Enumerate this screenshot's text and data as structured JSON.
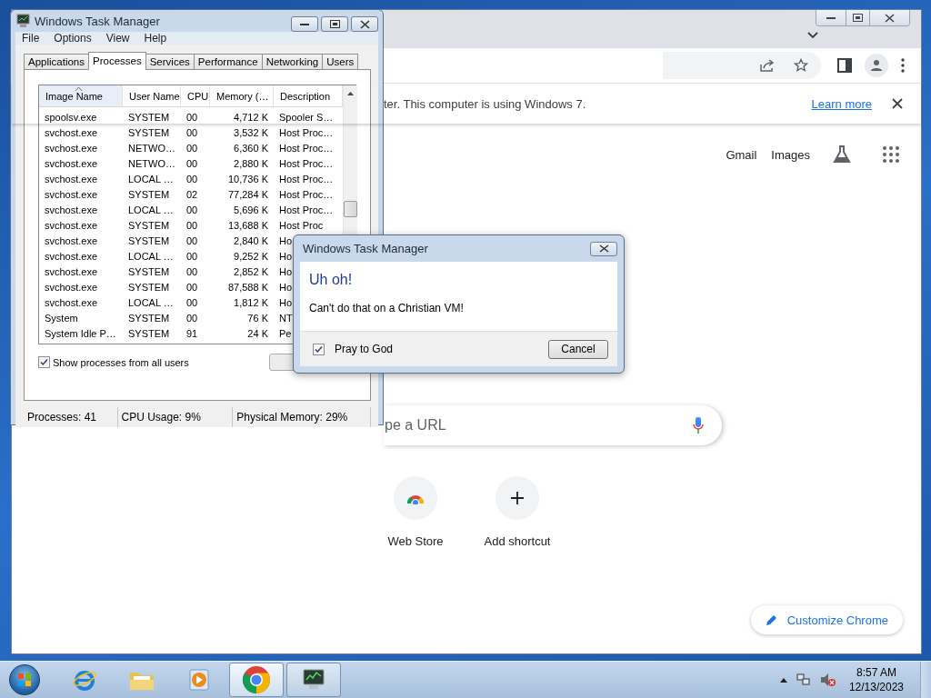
{
  "chrome": {
    "infobar": {
      "text": "ter. This computer is using Windows 7.",
      "link": "Learn more"
    },
    "header_links": [
      "Gmail",
      "Images"
    ],
    "search": {
      "placeholder": "pe a URL"
    },
    "shortcuts": [
      {
        "label": "Web Store",
        "kind": "store"
      },
      {
        "label": "Add shortcut",
        "kind": "add"
      }
    ],
    "customize_button": "Customize Chrome"
  },
  "task_manager": {
    "title": "Windows Task Manager",
    "menu": [
      "File",
      "Options",
      "View",
      "Help"
    ],
    "tabs": [
      {
        "label": "Applications",
        "selected": false
      },
      {
        "label": "Processes",
        "selected": true
      },
      {
        "label": "Services",
        "selected": false
      },
      {
        "label": "Performance",
        "selected": false
      },
      {
        "label": "Networking",
        "selected": false
      },
      {
        "label": "Users",
        "selected": false
      }
    ],
    "table": {
      "columns": [
        "Image Name",
        "User Name",
        "CPU",
        "Memory (…",
        "Description"
      ],
      "rows": [
        [
          "spoolsv.exe",
          "SYSTEM",
          "00",
          "4,712 K",
          "Spooler S…"
        ],
        [
          "svchost.exe",
          "SYSTEM",
          "00",
          "3,532 K",
          "Host Proc…"
        ],
        [
          "svchost.exe",
          "NETWO…",
          "00",
          "6,360 K",
          "Host Proc…"
        ],
        [
          "svchost.exe",
          "NETWO…",
          "00",
          "2,880 K",
          "Host Proc…"
        ],
        [
          "svchost.exe",
          "LOCAL …",
          "00",
          "10,736 K",
          "Host Proc…"
        ],
        [
          "svchost.exe",
          "SYSTEM",
          "02",
          "77,284 K",
          "Host Proc…"
        ],
        [
          "svchost.exe",
          "LOCAL …",
          "00",
          "5,696 K",
          "Host Proc…"
        ],
        [
          "svchost.exe",
          "SYSTEM",
          "00",
          "13,688 K",
          "Host Proc"
        ],
        [
          "svchost.exe",
          "SYSTEM",
          "00",
          "2,840 K",
          "Ho"
        ],
        [
          "svchost.exe",
          "LOCAL …",
          "00",
          "9,252 K",
          "Ho"
        ],
        [
          "svchost.exe",
          "SYSTEM",
          "00",
          "2,852 K",
          "Ho"
        ],
        [
          "svchost.exe",
          "SYSTEM",
          "00",
          "87,588 K",
          "Ho"
        ],
        [
          "svchost.exe",
          "LOCAL …",
          "00",
          "1,812 K",
          "Ho"
        ],
        [
          "System",
          "SYSTEM",
          "00",
          "76 K",
          "NT"
        ],
        [
          "System Idle P…",
          "SYSTEM",
          "91",
          "24 K",
          "Pe"
        ]
      ]
    },
    "show_all_users": {
      "label": "Show processes from all users",
      "checked": true
    },
    "status_bar": [
      "Processes: 41",
      "CPU Usage: 9%",
      "Physical Memory: 29%"
    ]
  },
  "dialog": {
    "title": "Windows Task Manager",
    "heading": "Uh oh!",
    "message": "Can't do that on a Christian VM!",
    "checkbox": {
      "label": "Pray to God",
      "checked": true
    },
    "button": "Cancel"
  },
  "taskbar": {
    "apps": [
      {
        "kind": "ie",
        "selected": false,
        "running": false
      },
      {
        "kind": "explorer",
        "selected": false,
        "running": false
      },
      {
        "kind": "media",
        "selected": false,
        "running": false
      },
      {
        "kind": "chrome",
        "selected": true,
        "running": true
      },
      {
        "kind": "taskmgr",
        "selected": false,
        "running": true
      }
    ],
    "clock": {
      "time": "8:57 AM",
      "date": "12/13/2023"
    }
  }
}
